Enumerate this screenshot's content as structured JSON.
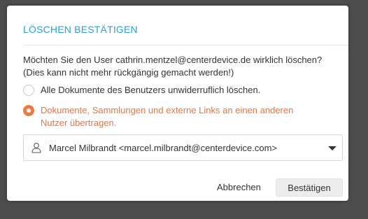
{
  "dialog": {
    "title": "LÖSCHEN BESTÄTIGEN",
    "message_line1": "Möchten Sie den User cathrin.mentzel@centerdevice.de wirklich löschen?",
    "message_line2": "(Dies kann nicht mehr rückgängig gemacht werden!)",
    "options": [
      {
        "label": "Alle Dokumente des Benutzers unwiderruflich löschen.",
        "checked": false
      },
      {
        "label_line1": "Dokumente, Sammlungen und externe Links an einen anderen",
        "label_line2": "Nutzer übertragen.",
        "checked": true
      }
    ],
    "select": {
      "icon": "user-icon",
      "value": "Marcel Milbrandt <marcel.milbrandt@centerdevice.com>"
    },
    "buttons": {
      "cancel": "Abbrechen",
      "confirm": "Bestätigen"
    }
  },
  "colors": {
    "title": "#2a9fd6",
    "accent": "#ee7a3c",
    "backdrop": "#4d4d4d"
  }
}
